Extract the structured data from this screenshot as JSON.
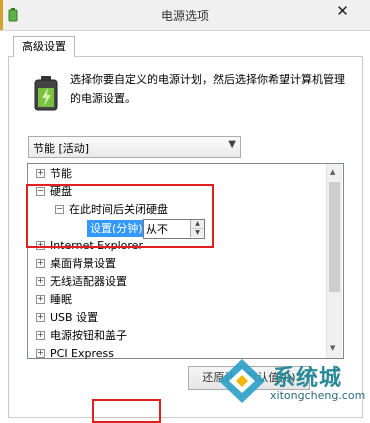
{
  "window": {
    "title": "电源选项",
    "close_glyph": "✕"
  },
  "tab": {
    "label": "高级设置"
  },
  "description": "选择你要自定义的电源计划，然后选择你希望计算机管理的电源设置。",
  "plan_select": {
    "value": "节能 [活动]"
  },
  "tree": {
    "items": [
      {
        "label": "节能",
        "expander": "⊞"
      },
      {
        "label": "硬盘",
        "expander": "⊟"
      },
      {
        "label": "在此时间后关闭硬盘",
        "expander": "⊟"
      },
      {
        "label": "Internet Explorer",
        "expander": "⊞"
      },
      {
        "label": "桌面背景设置",
        "expander": "⊞"
      },
      {
        "label": "无线适配器设置",
        "expander": "⊞"
      },
      {
        "label": "睡眠",
        "expander": "⊞"
      },
      {
        "label": "USB 设置",
        "expander": "⊞"
      },
      {
        "label": "电源按钮和盖子",
        "expander": "⊞"
      },
      {
        "label": "PCI Express",
        "expander": "⊞"
      }
    ],
    "setting": {
      "label": "设置(分钟):",
      "value": "从不"
    }
  },
  "buttons": {
    "restore_label": "还原计划默认值(R)"
  },
  "watermark": {
    "brand": "系统城",
    "url": "xitongcheng.com"
  },
  "colors": {
    "highlight": "#3399ff",
    "annotation": "#e02020"
  }
}
